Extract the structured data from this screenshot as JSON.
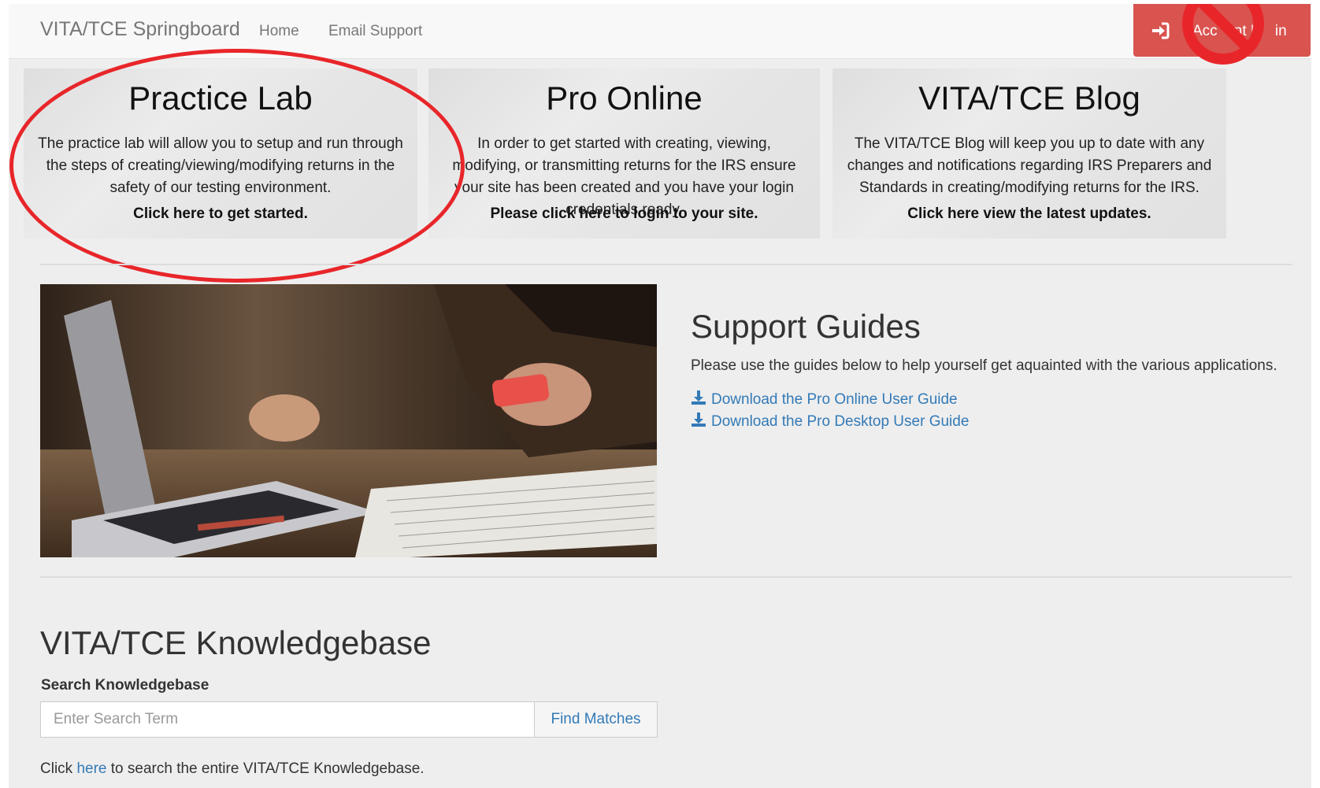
{
  "navbar": {
    "brand": "VITA/TCE Springboard",
    "links": [
      "Home",
      "Email Support"
    ],
    "login_label": "Account Login",
    "login_visible_text": "Acc    nt L    in"
  },
  "tiles": [
    {
      "title": "Practice Lab",
      "description": "The practice lab will allow you to setup and run through the steps of creating/viewing/modifying returns in the safety of our testing environment.",
      "cta": "Click here to get started."
    },
    {
      "title": "Pro Online",
      "description": "In order to get started with creating, viewing, modifying, or transmitting returns for the IRS ensure your site has been created and you have your login credentials ready.",
      "cta": "Please click here to login to your site."
    },
    {
      "title": "VITA/TCE Blog",
      "description": "The VITA/TCE Blog will keep you up to date with any changes and notifications regarding IRS Preparers and Standards in creating/modifying returns for the IRS.",
      "cta": "Click here view the latest updates."
    }
  ],
  "support": {
    "title": "Support Guides",
    "text": "Please use the guides below to help yourself get aquainted with the various applications.",
    "links": [
      "Download the Pro Online User Guide",
      "Download the Pro Desktop User Guide"
    ]
  },
  "knowledgebase": {
    "title": "VITA/TCE Knowledgebase",
    "search_label": "Search Knowledgebase",
    "search_placeholder": "Enter Search Term",
    "search_value": "",
    "button_label": "Find Matches",
    "footer_before": "Click ",
    "footer_link": "here",
    "footer_after": " to search the entire VITA/TCE Knowledgebase."
  },
  "colors": {
    "danger": "#d9534f",
    "link": "#337ab7",
    "annotation": "#e8262a",
    "background": "#eeeeee"
  },
  "icons": {
    "login": "sign-in-icon",
    "download": "download-icon",
    "annotation": "no-sign-icon"
  }
}
